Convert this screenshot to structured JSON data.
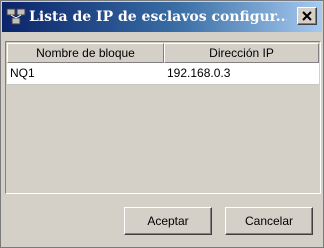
{
  "window": {
    "title": "Lista de IP de esclavos configur...",
    "icon": "network-app-icon",
    "close_icon": "close-icon"
  },
  "table": {
    "columns": [
      "Nombre de bloque",
      "Dirección IP"
    ],
    "rows": [
      [
        "NQ1",
        "192.168.0.3"
      ]
    ]
  },
  "buttons": {
    "accept_label": "Aceptar",
    "cancel_label": "Cancelar"
  },
  "colors": {
    "titlebar_start": "#0a246a",
    "titlebar_end": "#a6caf0",
    "dialog_bg": "#d4d0c8",
    "row_bg": "#ffffff"
  }
}
